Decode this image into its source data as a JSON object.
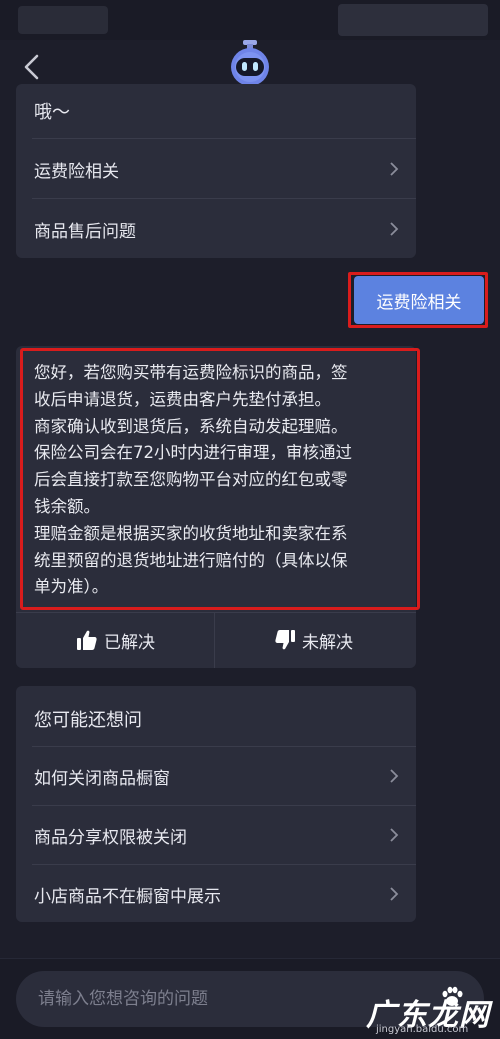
{
  "icons": {
    "back": "chevron-left-icon",
    "bot": "robot-avatar-icon",
    "chevron": "chevron-right-icon",
    "thumbs_up": "thumbs-up-icon",
    "thumbs_down": "thumbs-down-icon"
  },
  "colors": {
    "background": "#1d1e2a",
    "card": "#2b2d3b",
    "user_bubble": "#5c82e0",
    "highlight_outline": "#d91c1c"
  },
  "menu_card": {
    "intro": "哦～",
    "options": [
      {
        "label": "运费险相关"
      },
      {
        "label": "商品售后问题"
      }
    ]
  },
  "user_message": {
    "text": "运费险相关"
  },
  "answer": {
    "lines": [
      "您好，若您购买带有运费险标识的商品，签",
      "收后申请退货，运费由客户先垫付承担。",
      "商家确认收到退货后，系统自动发起理赔。",
      "保险公司会在72小时内进行审理，审核通过",
      "后会直接打款至您购物平台对应的红包或零",
      "钱余额。",
      "理赔金额是根据买家的收货地址和卖家在系",
      "统里预留的退货地址进行赔付的（具体以保",
      "单为准）。"
    ],
    "solved_label": "已解决",
    "unsolved_label": "未解决"
  },
  "suggestions": {
    "title": "您可能还想问",
    "items": [
      {
        "label": "如何关闭商品橱窗"
      },
      {
        "label": "商品分享权限被关闭"
      },
      {
        "label": "小店商品不在橱窗中展示"
      }
    ]
  },
  "input": {
    "placeholder": "请输入您想咨询的问题"
  },
  "watermark": {
    "title": "广东龙网",
    "url": "jingyan.baidu.com"
  }
}
